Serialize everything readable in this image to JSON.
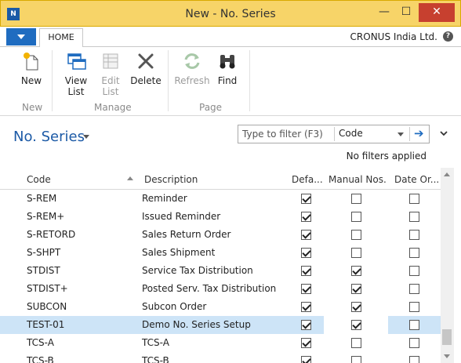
{
  "window": {
    "title": "New - No. Series",
    "min_glyph": "—",
    "max_glyph": "☐",
    "close_glyph": "✕"
  },
  "ribbon": {
    "tab_home": "HOME",
    "company": "CRONUS India Ltd.",
    "help_glyph": "?",
    "groups": {
      "new": "New",
      "manage": "Manage",
      "page": "Page"
    },
    "buttons": {
      "new": "New",
      "view_list": "View\nList",
      "edit_list": "Edit\nList",
      "delete": "Delete",
      "refresh": "Refresh",
      "find": "Find"
    }
  },
  "page": {
    "title": "No. Series",
    "filter_placeholder": "Type to filter (F3)",
    "filter_field": "Code",
    "filter_status": "No filters applied"
  },
  "grid": {
    "columns": {
      "code": "Code",
      "description": "Description",
      "default": "Defa...",
      "manual": "Manual Nos.",
      "date_order": "Date Or..."
    },
    "rows": [
      {
        "code": "S-REM",
        "description": "Reminder",
        "default": true,
        "manual": false,
        "date_order": false
      },
      {
        "code": "S-REM+",
        "description": "Issued Reminder",
        "default": true,
        "manual": false,
        "date_order": false
      },
      {
        "code": "S-RETORD",
        "description": "Sales Return Order",
        "default": true,
        "manual": false,
        "date_order": false
      },
      {
        "code": "S-SHPT",
        "description": "Sales Shipment",
        "default": true,
        "manual": false,
        "date_order": false
      },
      {
        "code": "STDIST",
        "description": "Service Tax Distribution",
        "default": true,
        "manual": true,
        "date_order": false
      },
      {
        "code": "STDIST+",
        "description": "Posted Serv. Tax Distribution",
        "default": true,
        "manual": true,
        "date_order": false
      },
      {
        "code": "SUBCON",
        "description": "Subcon Order",
        "default": true,
        "manual": true,
        "date_order": false
      },
      {
        "code": "TEST-01",
        "description": "Demo No. Series Setup",
        "default": true,
        "manual": true,
        "date_order": false,
        "selected": true
      },
      {
        "code": "TCS-A",
        "description": "TCS-A",
        "default": true,
        "manual": false,
        "date_order": false
      },
      {
        "code": "TCS-B",
        "description": "TCS-B",
        "default": true,
        "manual": false,
        "date_order": false
      }
    ]
  },
  "colors": {
    "titlebar": "#f7d468",
    "accent": "#1f6cc0",
    "selected_row": "#cde4f7",
    "close": "#c7402f"
  }
}
